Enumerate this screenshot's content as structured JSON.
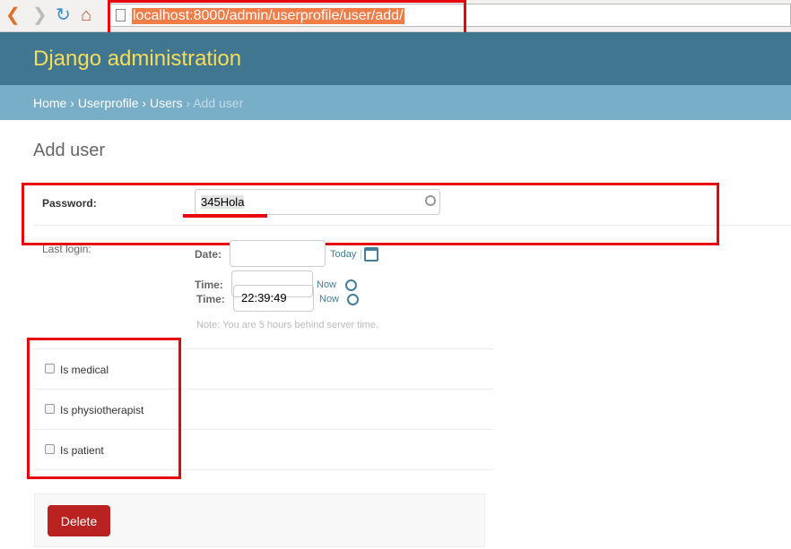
{
  "browser": {
    "url": "localhost:8000/admin/userprofile/user/add/"
  },
  "header": {
    "title": "Django administration"
  },
  "breadcrumbs": {
    "home": "Home",
    "app": "Userprofile",
    "model": "Users",
    "current": "Add user",
    "sep": "›"
  },
  "page": {
    "title": "Add user"
  },
  "form": {
    "password_label": "Password:",
    "password_value": "345Hola",
    "last_login_label": "Last login:",
    "date_label": "Date:",
    "date_value": "",
    "today_link": "Today",
    "time_label": "Time:",
    "time_value_1": "",
    "time_value_2": "22:39:49",
    "now_link": "Now",
    "note": "Note: You are 5 hours behind server time.",
    "checkboxes": [
      {
        "label": "Is medical",
        "checked": false
      },
      {
        "label": "Is physiotherapist",
        "checked": false
      },
      {
        "label": "Is patient",
        "checked": false
      }
    ],
    "delete_label": "Delete"
  },
  "colors": {
    "header": "#417690",
    "breadcrumbs": "#79aec8",
    "brand": "#f5dd5d",
    "delete": "#ba2121",
    "annotation": "#e5070d"
  }
}
